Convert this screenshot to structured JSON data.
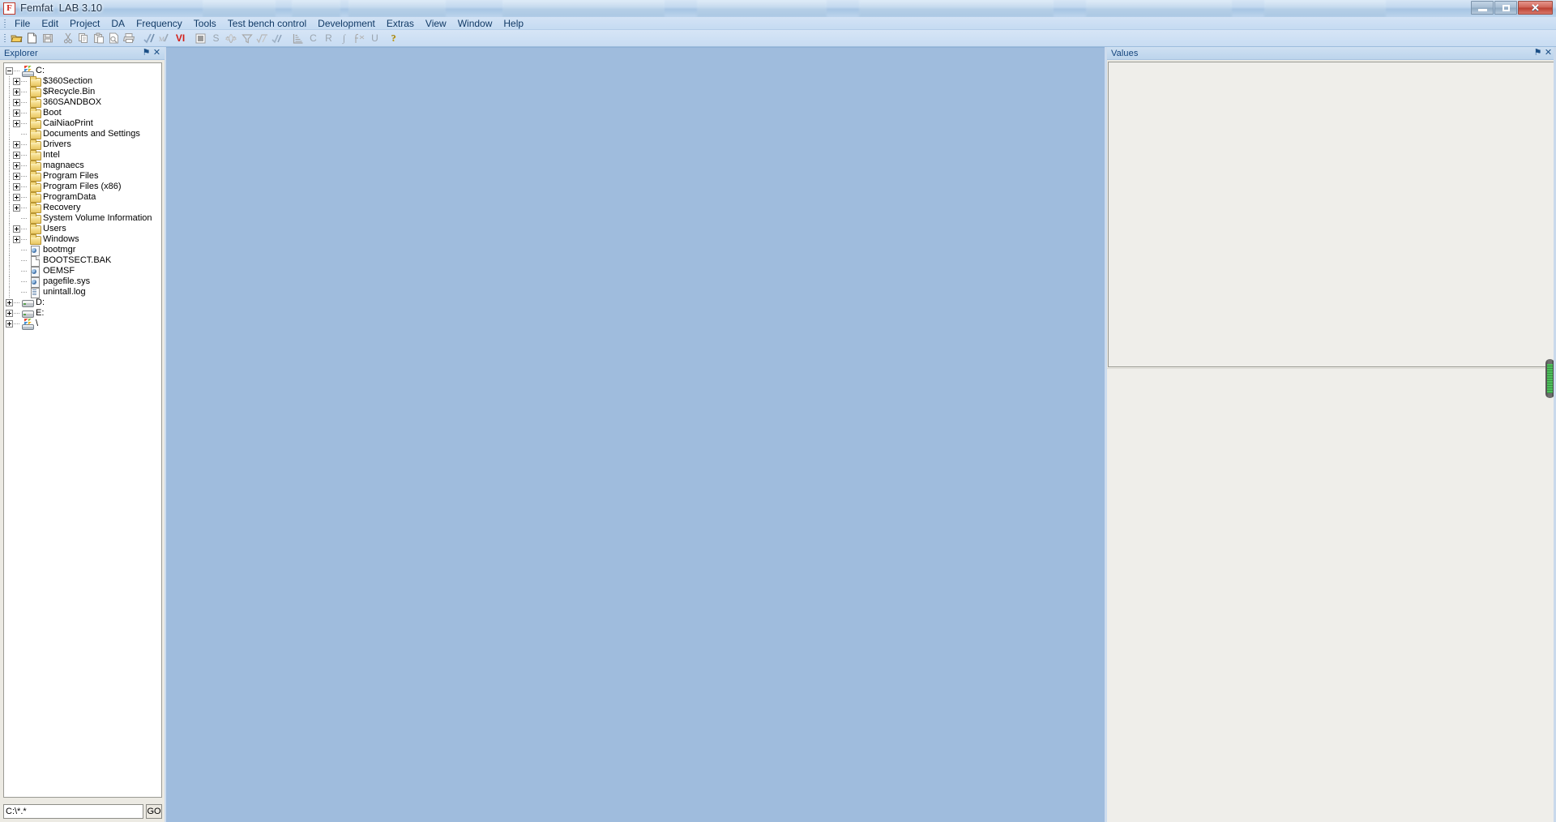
{
  "window": {
    "title": "Femfat  LAB 3.10",
    "app_icon": "F",
    "minimize_label": "Minimize",
    "restore_label": "Restore",
    "close_label": "Close"
  },
  "menu": {
    "items": [
      "File",
      "Edit",
      "Project",
      "DA",
      "Frequency",
      "Tools",
      "Test bench control",
      "Development",
      "Extras",
      "View",
      "Window",
      "Help"
    ]
  },
  "toolbar": {
    "buttons": [
      {
        "name": "open-folder-icon",
        "glyph": "",
        "kind": "open"
      },
      {
        "name": "new-document-icon",
        "glyph": "",
        "kind": "new"
      },
      {
        "name": "save-icon",
        "glyph": "",
        "kind": "save"
      },
      {
        "name": "cut-icon",
        "glyph": "",
        "kind": "cut"
      },
      {
        "name": "copy-icon",
        "glyph": "",
        "kind": "copy"
      },
      {
        "name": "paste-icon",
        "glyph": "",
        "kind": "paste"
      },
      {
        "name": "print-preview-icon",
        "glyph": "",
        "kind": "preview"
      },
      {
        "name": "print-icon",
        "glyph": "",
        "kind": "print"
      },
      {
        "name": "check-curve-icon",
        "glyph": "",
        "kind": "checkcurve"
      },
      {
        "name": "measure-curve-icon",
        "glyph": "",
        "kind": "mcurve"
      },
      {
        "name": "vi-icon",
        "glyph": "VI",
        "kind": "text-red"
      },
      {
        "name": "window-icon",
        "glyph": "",
        "kind": "window"
      },
      {
        "name": "spectrum-s-icon",
        "glyph": "S",
        "kind": "text-plain"
      },
      {
        "name": "waveform-icon",
        "glyph": "",
        "kind": "waveform"
      },
      {
        "name": "filter-icon",
        "glyph": "",
        "kind": "filter"
      },
      {
        "name": "rms-icon",
        "glyph": "",
        "kind": "rms"
      },
      {
        "name": "check-signal-icon",
        "glyph": "",
        "kind": "checksig"
      },
      {
        "name": "histogram-icon",
        "glyph": "",
        "kind": "histogram"
      },
      {
        "name": "counting-c-icon",
        "glyph": "C",
        "kind": "text-plain"
      },
      {
        "name": "rainflow-r-icon",
        "glyph": "R",
        "kind": "text-plain"
      },
      {
        "name": "integral-icon",
        "glyph": "∫",
        "kind": "text-italic"
      },
      {
        "name": "fx-icon",
        "glyph": "",
        "kind": "fx"
      },
      {
        "name": "underline-u-icon",
        "glyph": "U",
        "kind": "text-plain"
      },
      {
        "name": "help-icon",
        "glyph": "",
        "kind": "help"
      }
    ]
  },
  "explorer": {
    "title": "Explorer",
    "pin_label": "⚑",
    "close_label": "✕",
    "path_value": "C:\\*.*",
    "path_placeholder": "C:\\*.*",
    "go_label": "GO",
    "tree": [
      {
        "label": "C:",
        "depth": 0,
        "icon": "computer",
        "expander": "minus"
      },
      {
        "label": "$360Section",
        "depth": 1,
        "icon": "folder",
        "expander": "plus"
      },
      {
        "label": "$Recycle.Bin",
        "depth": 1,
        "icon": "folder",
        "expander": "plus"
      },
      {
        "label": "360SANDBOX",
        "depth": 1,
        "icon": "folder",
        "expander": "plus"
      },
      {
        "label": "Boot",
        "depth": 1,
        "icon": "folder",
        "expander": "plus"
      },
      {
        "label": "CaiNiaoPrint",
        "depth": 1,
        "icon": "folder",
        "expander": "plus"
      },
      {
        "label": "Documents and Settings",
        "depth": 1,
        "icon": "folder",
        "expander": "none"
      },
      {
        "label": "Drivers",
        "depth": 1,
        "icon": "folder",
        "expander": "plus"
      },
      {
        "label": "Intel",
        "depth": 1,
        "icon": "folder",
        "expander": "plus"
      },
      {
        "label": "magnaecs",
        "depth": 1,
        "icon": "folder",
        "expander": "plus"
      },
      {
        "label": "Program Files",
        "depth": 1,
        "icon": "folder",
        "expander": "plus"
      },
      {
        "label": "Program Files (x86)",
        "depth": 1,
        "icon": "folder",
        "expander": "plus"
      },
      {
        "label": "ProgramData",
        "depth": 1,
        "icon": "folder",
        "expander": "plus"
      },
      {
        "label": "Recovery",
        "depth": 1,
        "icon": "folder",
        "expander": "plus"
      },
      {
        "label": "System Volume Information",
        "depth": 1,
        "icon": "folder",
        "expander": "none"
      },
      {
        "label": "Users",
        "depth": 1,
        "icon": "folder",
        "expander": "plus"
      },
      {
        "label": "Windows",
        "depth": 1,
        "icon": "folder",
        "expander": "plus"
      },
      {
        "label": "bootmgr",
        "depth": 1,
        "icon": "sysfile",
        "expander": "none"
      },
      {
        "label": "BOOTSECT.BAK",
        "depth": 1,
        "icon": "file",
        "expander": "none"
      },
      {
        "label": "OEMSF",
        "depth": 1,
        "icon": "sysfile",
        "expander": "none"
      },
      {
        "label": "pagefile.sys",
        "depth": 1,
        "icon": "sysfile",
        "expander": "none"
      },
      {
        "label": "unintall.log",
        "depth": 1,
        "icon": "logfile",
        "expander": "none"
      },
      {
        "label": "D:",
        "depth": 0,
        "icon": "drive",
        "expander": "plus"
      },
      {
        "label": "E:",
        "depth": 0,
        "icon": "drive",
        "expander": "plus"
      },
      {
        "label": "\\",
        "depth": 0,
        "icon": "computer",
        "expander": "plus"
      }
    ]
  },
  "values": {
    "title": "Values",
    "pin_label": "⚑",
    "close_label": "✕"
  },
  "colors": {
    "accent": "#13447c",
    "titlebar_text": "#26384d",
    "workspace": "#9fbcdd",
    "panel_bg": "#eceae3",
    "scroll_green": "#4cc05a",
    "vi_red": "#d21f18"
  }
}
